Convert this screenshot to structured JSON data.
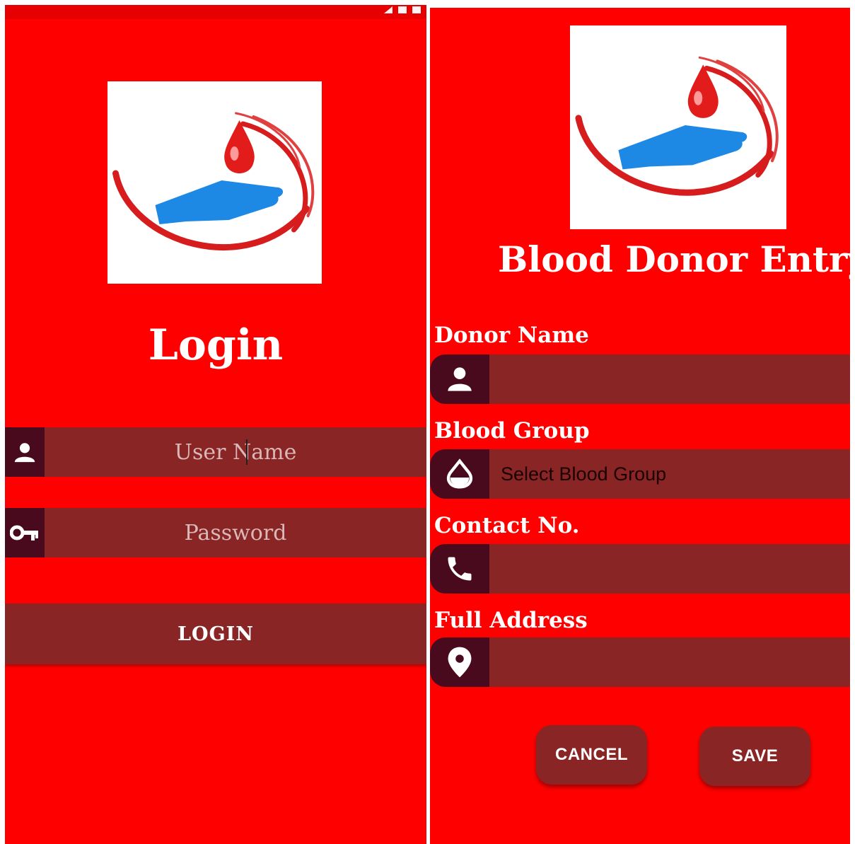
{
  "login_screen": {
    "title": "Login",
    "username": {
      "placeholder": "User Name"
    },
    "password": {
      "placeholder": "Password"
    },
    "login_button": "LOGIN"
  },
  "entry_screen": {
    "title": "Blood Donor Entry",
    "fields": {
      "donor_name": {
        "label": "Donor Name",
        "value": ""
      },
      "blood_group": {
        "label": "Blood Group",
        "selected": "Select Blood Group"
      },
      "contact": {
        "label": "Contact No.",
        "value": ""
      },
      "address": {
        "label": "Full Address",
        "value": ""
      }
    },
    "cancel_button": "CANCEL",
    "save_button": "SAVE"
  },
  "icons": {
    "user": "user-icon",
    "key": "key-icon",
    "drop": "drop-icon",
    "phone": "phone-icon",
    "location": "location-pin-icon",
    "logo": "blood-donation-logo"
  },
  "colors": {
    "background": "#ff0000",
    "field": "#8a2525",
    "icon_cell": "#4a0a1e",
    "text": "#ffffff",
    "logo_hand": "#1e88e5",
    "logo_drop": "#e21b1b"
  }
}
